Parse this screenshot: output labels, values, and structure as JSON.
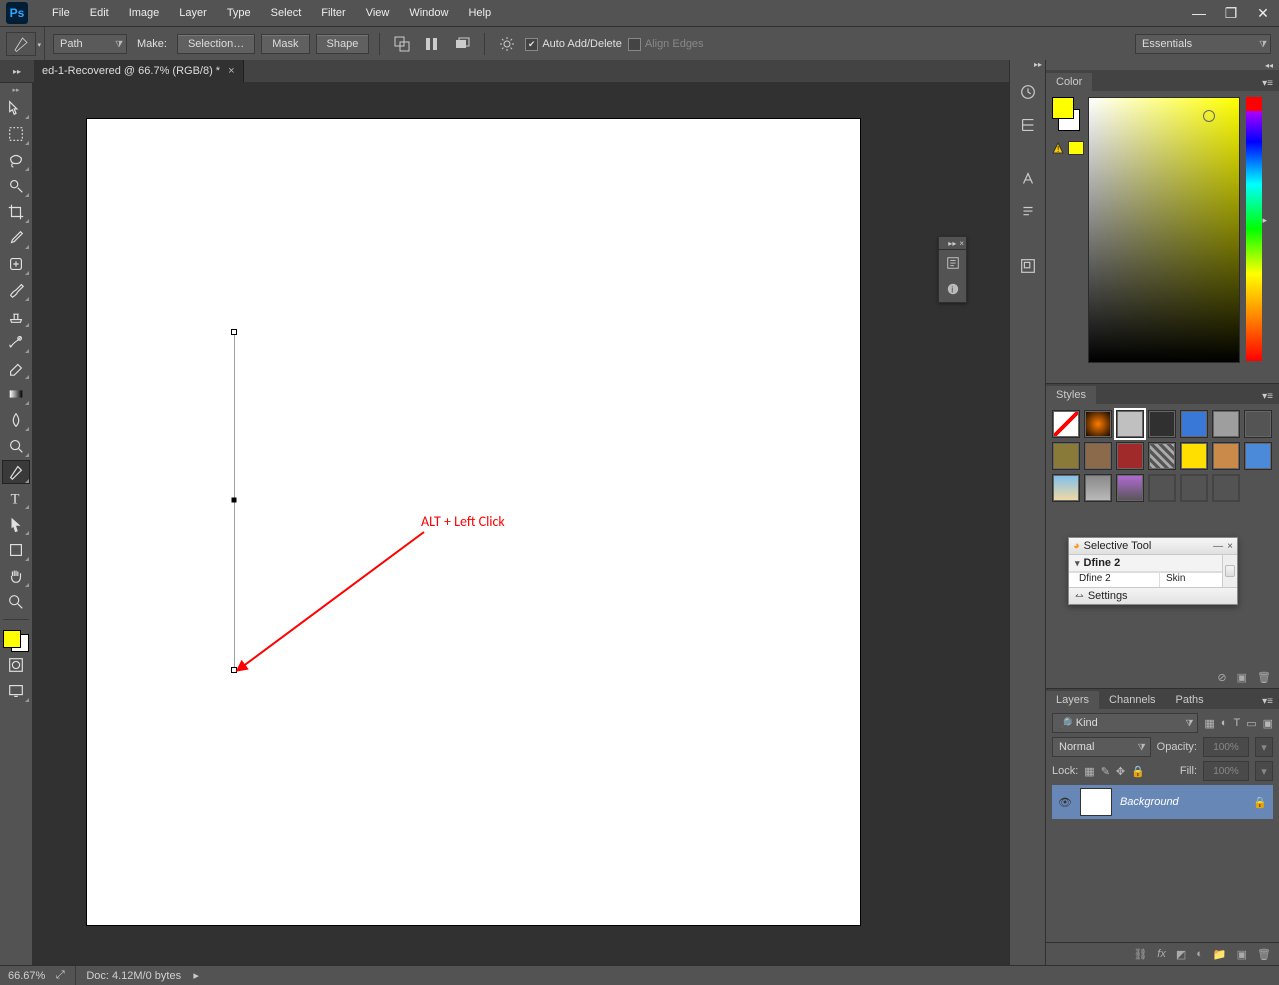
{
  "app": {
    "logo_text": "Ps"
  },
  "menu": [
    "File",
    "Edit",
    "Image",
    "Layer",
    "Type",
    "Select",
    "Filter",
    "View",
    "Window",
    "Help"
  ],
  "options": {
    "tool": "Pen",
    "mode": "Path",
    "make_label": "Make:",
    "btn_selection": "Selection…",
    "btn_mask": "Mask",
    "btn_shape": "Shape",
    "chk_auto": "Auto Add/Delete",
    "chk_align": "Align Edges",
    "workspace": "Essentials"
  },
  "document": {
    "tab": "ed-1-Recovered @ 66.7% (RGB/8) *"
  },
  "annotation": {
    "text": "ALT + Left Click"
  },
  "panels": {
    "color_tab": "Color",
    "styles_tab": "Styles",
    "layers_tabs": [
      "Layers",
      "Channels",
      "Paths"
    ],
    "layers": {
      "kind": "Kind",
      "blend": "Normal",
      "opacity_label": "Opacity:",
      "opacity_value": "100%",
      "lock_label": "Lock:",
      "fill_label": "Fill:",
      "fill_value": "100%",
      "layer_name": "Background"
    }
  },
  "selective": {
    "title": "Selective Tool",
    "group": "Dfine 2",
    "row1_name": "Dfine 2",
    "row1_action": "Skin",
    "settings": "Settings"
  },
  "status": {
    "zoom": "66.67%",
    "doc": "Doc: 4.12M/0 bytes"
  },
  "swatches": {
    "fg": "#ffff00",
    "bg": "#ffffff"
  },
  "style_colors": [
    "none",
    "#ff5500|#000",
    "#c0c0c0",
    "#303030",
    "#3a78d8",
    "#9e9e9e",
    "#545454",
    "#8a7a3a",
    "#8a6a4a",
    "#a02a2a",
    "mosaic",
    "#ffdf00",
    "#c98a4a",
    "#4a8ad8",
    "photo",
    "fxgrey",
    "purplegrad",
    "#808080empty",
    "#808080empty2",
    "#808080empty3"
  ]
}
